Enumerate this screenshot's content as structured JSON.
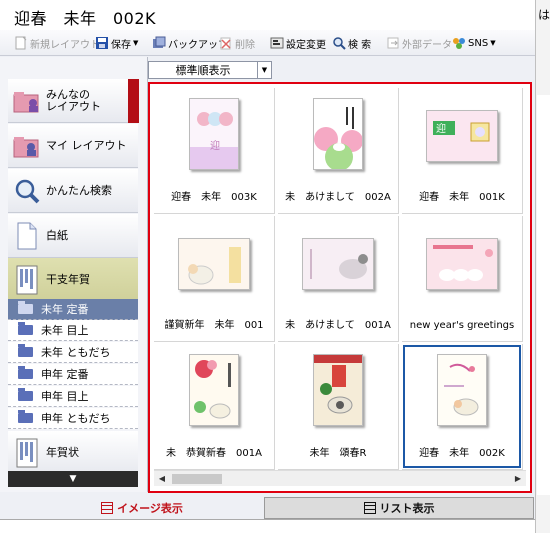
{
  "window": {
    "title": "迎春　未年　002K",
    "edge_glyph": "は"
  },
  "toolbar": {
    "new_layout": "新規レイアウト",
    "save": "保存",
    "backup": "バックアップ",
    "delete": "削除",
    "settings": "設定変更",
    "search": "検 索",
    "external_data": "外部データ",
    "sns": "SNS"
  },
  "sidebar": {
    "items": [
      {
        "label_line1": "みんなの",
        "label_line2": "レイアウト"
      },
      {
        "label": "マイ レイアウト"
      },
      {
        "label": "かんたん検索"
      },
      {
        "label": "白紙"
      },
      {
        "label": "干支年賀"
      }
    ],
    "sub_items": [
      "未年 定番",
      "未年 目上",
      "未年 ともだち",
      "申年 定番",
      "申年 目上",
      "申年 ともだち"
    ],
    "more_item": {
      "label": "年賀状"
    },
    "scroll_down": "▼"
  },
  "sort": {
    "selected": "標準順表示"
  },
  "gallery": {
    "items": [
      {
        "caption": "迎春　未年　003K",
        "orientation": "portrait"
      },
      {
        "caption": "未　あけまして　002A",
        "orientation": "portrait"
      },
      {
        "caption": "迎春　未年　001K",
        "orientation": "landscape"
      },
      {
        "caption": "謹賀新年　未年　001",
        "orientation": "landscape"
      },
      {
        "caption": "未　あけまして　001A",
        "orientation": "landscape"
      },
      {
        "caption": "new year's greetings",
        "orientation": "landscape"
      },
      {
        "caption": "未　恭賀新春　001A",
        "orientation": "portrait"
      },
      {
        "caption": "未年　頌春R",
        "orientation": "portrait"
      },
      {
        "caption": "迎春　未年　002K",
        "orientation": "portrait"
      }
    ],
    "selected_index": 8
  },
  "view_tabs": {
    "image": "イメージ表示",
    "list": "リスト表示"
  },
  "colors": {
    "highlight_border": "#e00010",
    "selected_border": "#1c58a6",
    "accent_red": "#b30e16"
  }
}
